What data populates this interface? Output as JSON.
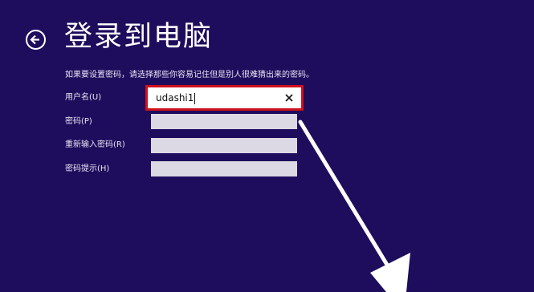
{
  "header": {
    "title": "登录到电脑",
    "back_icon": "back-arrow-icon"
  },
  "form": {
    "instruction": "如果要设置密码，请选择那些你容易记住但是别人很难猜出来的密码。",
    "username": {
      "label": "用户名(U)",
      "value": "udashi1",
      "clear_icon": "close-icon"
    },
    "password": {
      "label": "密码(P)",
      "value": ""
    },
    "confirm_password": {
      "label": "重新输入密码(R)",
      "value": ""
    },
    "password_hint": {
      "label": "密码提示(H)",
      "value": ""
    }
  },
  "colors": {
    "background": "#1e0c5c",
    "highlight_frame": "#d0101c",
    "annotation_arrow": "#ffffff"
  }
}
